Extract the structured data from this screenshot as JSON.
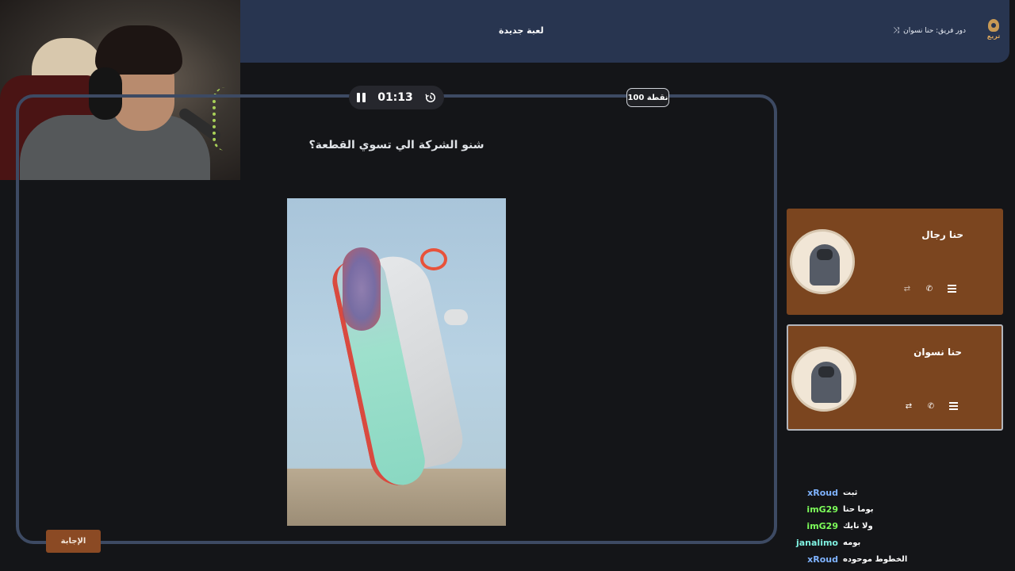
{
  "header": {
    "title": "لعبة جديدة",
    "turn_text": "دور فريق: حنا نسوان",
    "logo_text": "تريع"
  },
  "game": {
    "timer": "01:13",
    "points": "100 نقطة",
    "question": "شنو الشركة الي تسوي القطعة؟",
    "answer_button": "الإجابة"
  },
  "teams": [
    {
      "name": "حنا رجال",
      "active": false
    },
    {
      "name": "حنا نسوان",
      "active": true
    }
  ],
  "chat": [
    {
      "user": "xRoud",
      "message": "ثبت",
      "color": "#7fb3ff"
    },
    {
      "user": "imG29",
      "message": "بوما حنا",
      "color": "#7dff5a"
    },
    {
      "user": "imG29",
      "message": "ولا نايك",
      "color": "#7dff5a"
    },
    {
      "user": "janalimo",
      "message": "بومه",
      "color": "#7ff0e0"
    },
    {
      "user": "xRoud",
      "message": "الخطوط موحوده",
      "color": "#7fb3ff"
    }
  ],
  "colors": {
    "header_bg": "#283550",
    "board_border": "#3d4a63",
    "team_card_bg": "#7b451f",
    "answer_button_bg": "#8b4a24"
  },
  "icons": [
    "pause-icon",
    "history-icon",
    "shuffle-icon",
    "swap-icon",
    "phone-icon",
    "list-icon"
  ]
}
